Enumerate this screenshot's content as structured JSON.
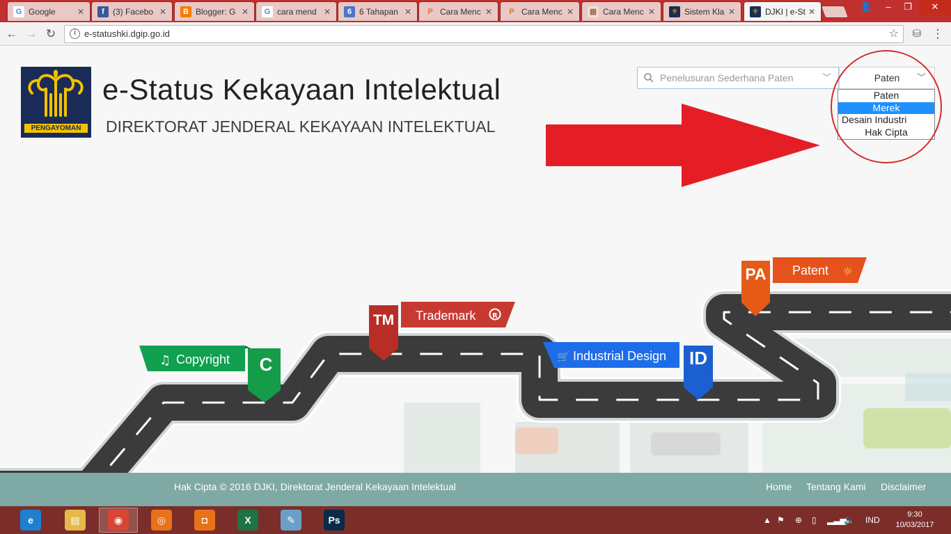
{
  "browser": {
    "tabs": [
      {
        "title": "Google",
        "favicon": "G",
        "favicon_color": "#4285f4",
        "favicon_bg": "#ffffff"
      },
      {
        "title": "(3) Facebo",
        "favicon": "f",
        "favicon_color": "#ffffff",
        "favicon_bg": "#3b5998"
      },
      {
        "title": "Blogger: G",
        "favicon": "B",
        "favicon_color": "#ffffff",
        "favicon_bg": "#f57d00"
      },
      {
        "title": "cara mend",
        "favicon": "G",
        "favicon_color": "#4285f4",
        "favicon_bg": "#ffffff"
      },
      {
        "title": "6 Tahapan",
        "favicon": "6",
        "favicon_color": "#ffffff",
        "favicon_bg": "#4a76c9"
      },
      {
        "title": "Cara Menc",
        "favicon": "P",
        "favicon_color": "#e8721a",
        "favicon_bg": "#e9c8c5"
      },
      {
        "title": "Cara Menc",
        "favicon": "P",
        "favicon_color": "#e8721a",
        "favicon_bg": "#e9c8c5"
      },
      {
        "title": "Cara Menc",
        "favicon": "▦",
        "favicon_color": "#8a3b2e",
        "favicon_bg": "#f0e0d0"
      },
      {
        "title": "Sistem Kla",
        "favicon": "⚜",
        "favicon_color": "#d8a800",
        "favicon_bg": "#1a2b57"
      },
      {
        "title": "DJKI | e-St",
        "favicon": "⚜",
        "favicon_color": "#d8a800",
        "favicon_bg": "#1a2b57"
      }
    ],
    "active_tab": 9,
    "url": "e-statushki.dgip.go.id"
  },
  "header": {
    "logo_text": "PENGAYOMAN",
    "title": "e-Status Kekayaan Intelektual",
    "subtitle": "DIREKTORAT JENDERAL KEKAYAAN INTELEKTUAL"
  },
  "search": {
    "placeholder": "Penelusuran Sederhana Paten",
    "selected_type": "Paten",
    "options": [
      "Paten",
      "Merek",
      "Desain Industri",
      "Hak Cipta"
    ],
    "highlighted_option": "Merek"
  },
  "roadmap": {
    "copyright": {
      "label": "Copyright",
      "code": "C",
      "color": "#18a050"
    },
    "trademark": {
      "label": "Trademark",
      "code": "TM",
      "color": "#c0392b"
    },
    "industrial_design": {
      "label": "Industrial Design",
      "code": "ID",
      "color": "#1e6de8"
    },
    "patent": {
      "label": "Patent",
      "code": "PA",
      "color": "#e5521b"
    }
  },
  "footer": {
    "copyright": "Hak Cipta © 2016 DJKI, Direktorat Jenderal Kekayaan Intelektual",
    "links": [
      "Home",
      "Tentang Kami",
      "Disclaimer"
    ]
  },
  "taskbar": {
    "language": "IND",
    "time": "9:30",
    "date": "10/03/2017",
    "apps": [
      {
        "name": "internet-explorer-icon",
        "glyph": "e",
        "bg": "#1f7fd1"
      },
      {
        "name": "file-explorer-icon",
        "glyph": "▤",
        "bg": "#e5b84a"
      },
      {
        "name": "chrome-icon",
        "glyph": "◉",
        "bg": "#d94535"
      },
      {
        "name": "screen-capture-icon",
        "glyph": "◎",
        "bg": "#e8721a"
      },
      {
        "name": "camera-icon",
        "glyph": "◘",
        "bg": "#e8721a"
      },
      {
        "name": "excel-icon",
        "glyph": "X",
        "bg": "#1f7244"
      },
      {
        "name": "paint-icon",
        "glyph": "✎",
        "bg": "#6aa0c8"
      },
      {
        "name": "photoshop-icon",
        "glyph": "Ps",
        "bg": "#0a2a4a"
      }
    ]
  }
}
